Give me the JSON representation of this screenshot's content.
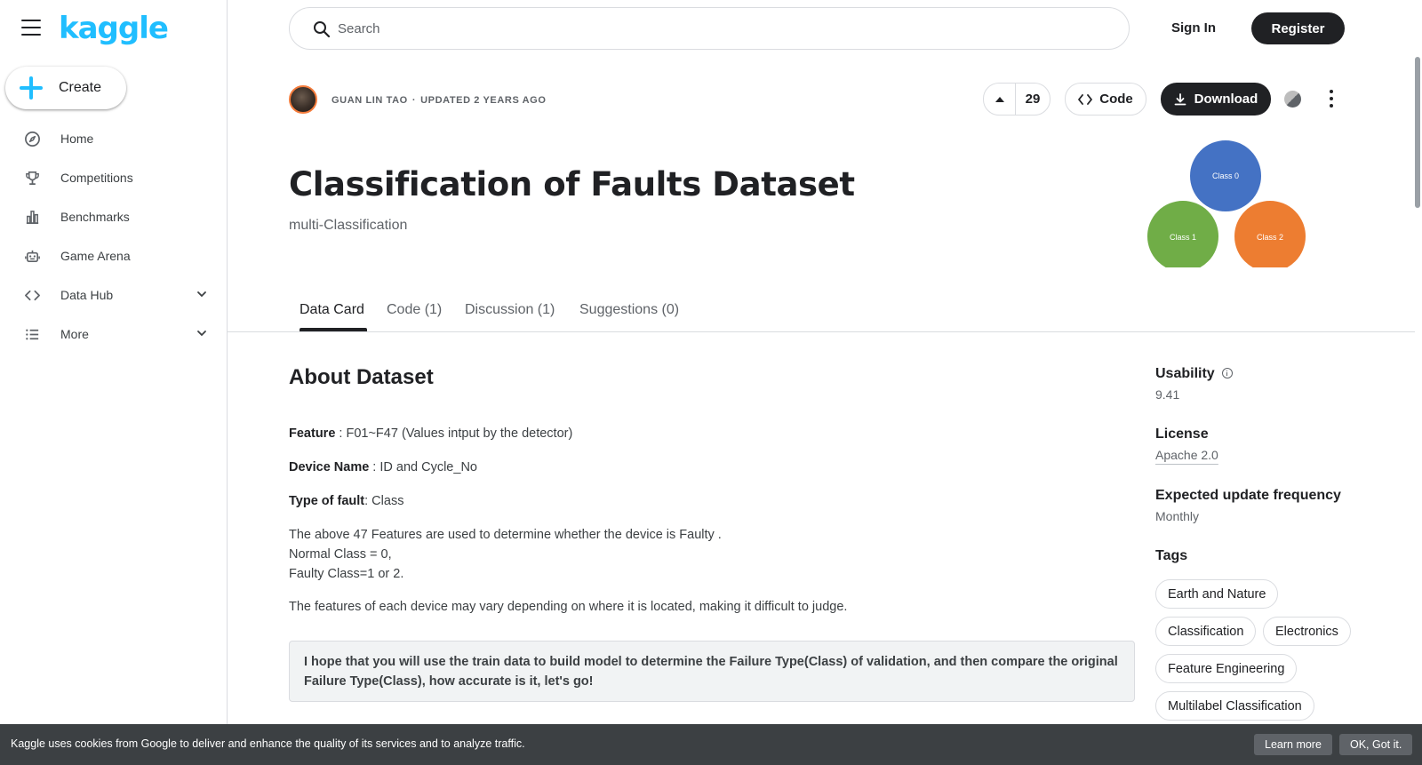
{
  "brand": {
    "logo_text": "kaggle",
    "accent": "#20beff"
  },
  "sidebar": {
    "create_label": "Create",
    "items": [
      {
        "label": "Home",
        "icon": "compass-icon"
      },
      {
        "label": "Competitions",
        "icon": "trophy-icon"
      },
      {
        "label": "Benchmarks",
        "icon": "bar-chart-icon"
      },
      {
        "label": "Game Arena",
        "icon": "robot-icon"
      },
      {
        "label": "Data Hub",
        "icon": "code-brackets-icon",
        "expandable": true
      },
      {
        "label": "More",
        "icon": "list-icon",
        "expandable": true
      }
    ]
  },
  "topbar": {
    "search_placeholder": "Search",
    "signin_label": "Sign In",
    "register_label": "Register"
  },
  "header": {
    "author": "GUAN LIN TAO",
    "separator": "·",
    "updated": "UPDATED 2 YEARS AGO",
    "votes": "29",
    "code_label": "Code",
    "download_label": "Download",
    "title": "Classification of Faults Dataset",
    "subtitle": "multi-Classification",
    "cover": {
      "circles": [
        {
          "label": "Class 0",
          "color": "#4472c4"
        },
        {
          "label": "Class 1",
          "color": "#70ad47"
        },
        {
          "label": "Class 2",
          "color": "#ed7d31"
        }
      ]
    }
  },
  "tabs": [
    {
      "label": "Data Card",
      "active": true
    },
    {
      "label": "Code (1)",
      "active": false
    },
    {
      "label": "Discussion (1)",
      "active": false
    },
    {
      "label": "Suggestions (0)",
      "active": false
    }
  ],
  "content": {
    "heading": "About Dataset",
    "feature_label": "Feature",
    "feature_value": " : F01~F47 (Values intput by the detector)",
    "device_label": "Device Name",
    "device_value": " : ID and Cycle_No",
    "fault_label": "Type of fault",
    "fault_value": ": Class",
    "para_line1": "The above 47 Features are used to determine whether the device is Faulty .",
    "para_line2": "Normal Class = 0,",
    "para_line3": "Faulty Class=1 or 2.",
    "para_features": "The features of each device may vary depending on where it is located, making it difficult to judge.",
    "callout": "I hope that you will use the train data to build model to determine the Failure Type(Class) of validation, and then compare the original Failure Type(Class), how accurate is it, let's go!"
  },
  "right_panel": {
    "usability_label": "Usability",
    "usability_value": "9.41",
    "license_label": "License",
    "license_value": "Apache 2.0",
    "frequency_label": "Expected update frequency",
    "frequency_value": "Monthly",
    "tags_label": "Tags",
    "tags": [
      "Earth and Nature",
      "Classification",
      "Electronics",
      "Feature Engineering",
      "Multilabel Classification"
    ]
  },
  "cookie": {
    "text": "Kaggle uses cookies from Google to deliver and enhance the quality of its services and to analyze traffic.",
    "learn_more": "Learn more",
    "ok": "OK, Got it."
  }
}
